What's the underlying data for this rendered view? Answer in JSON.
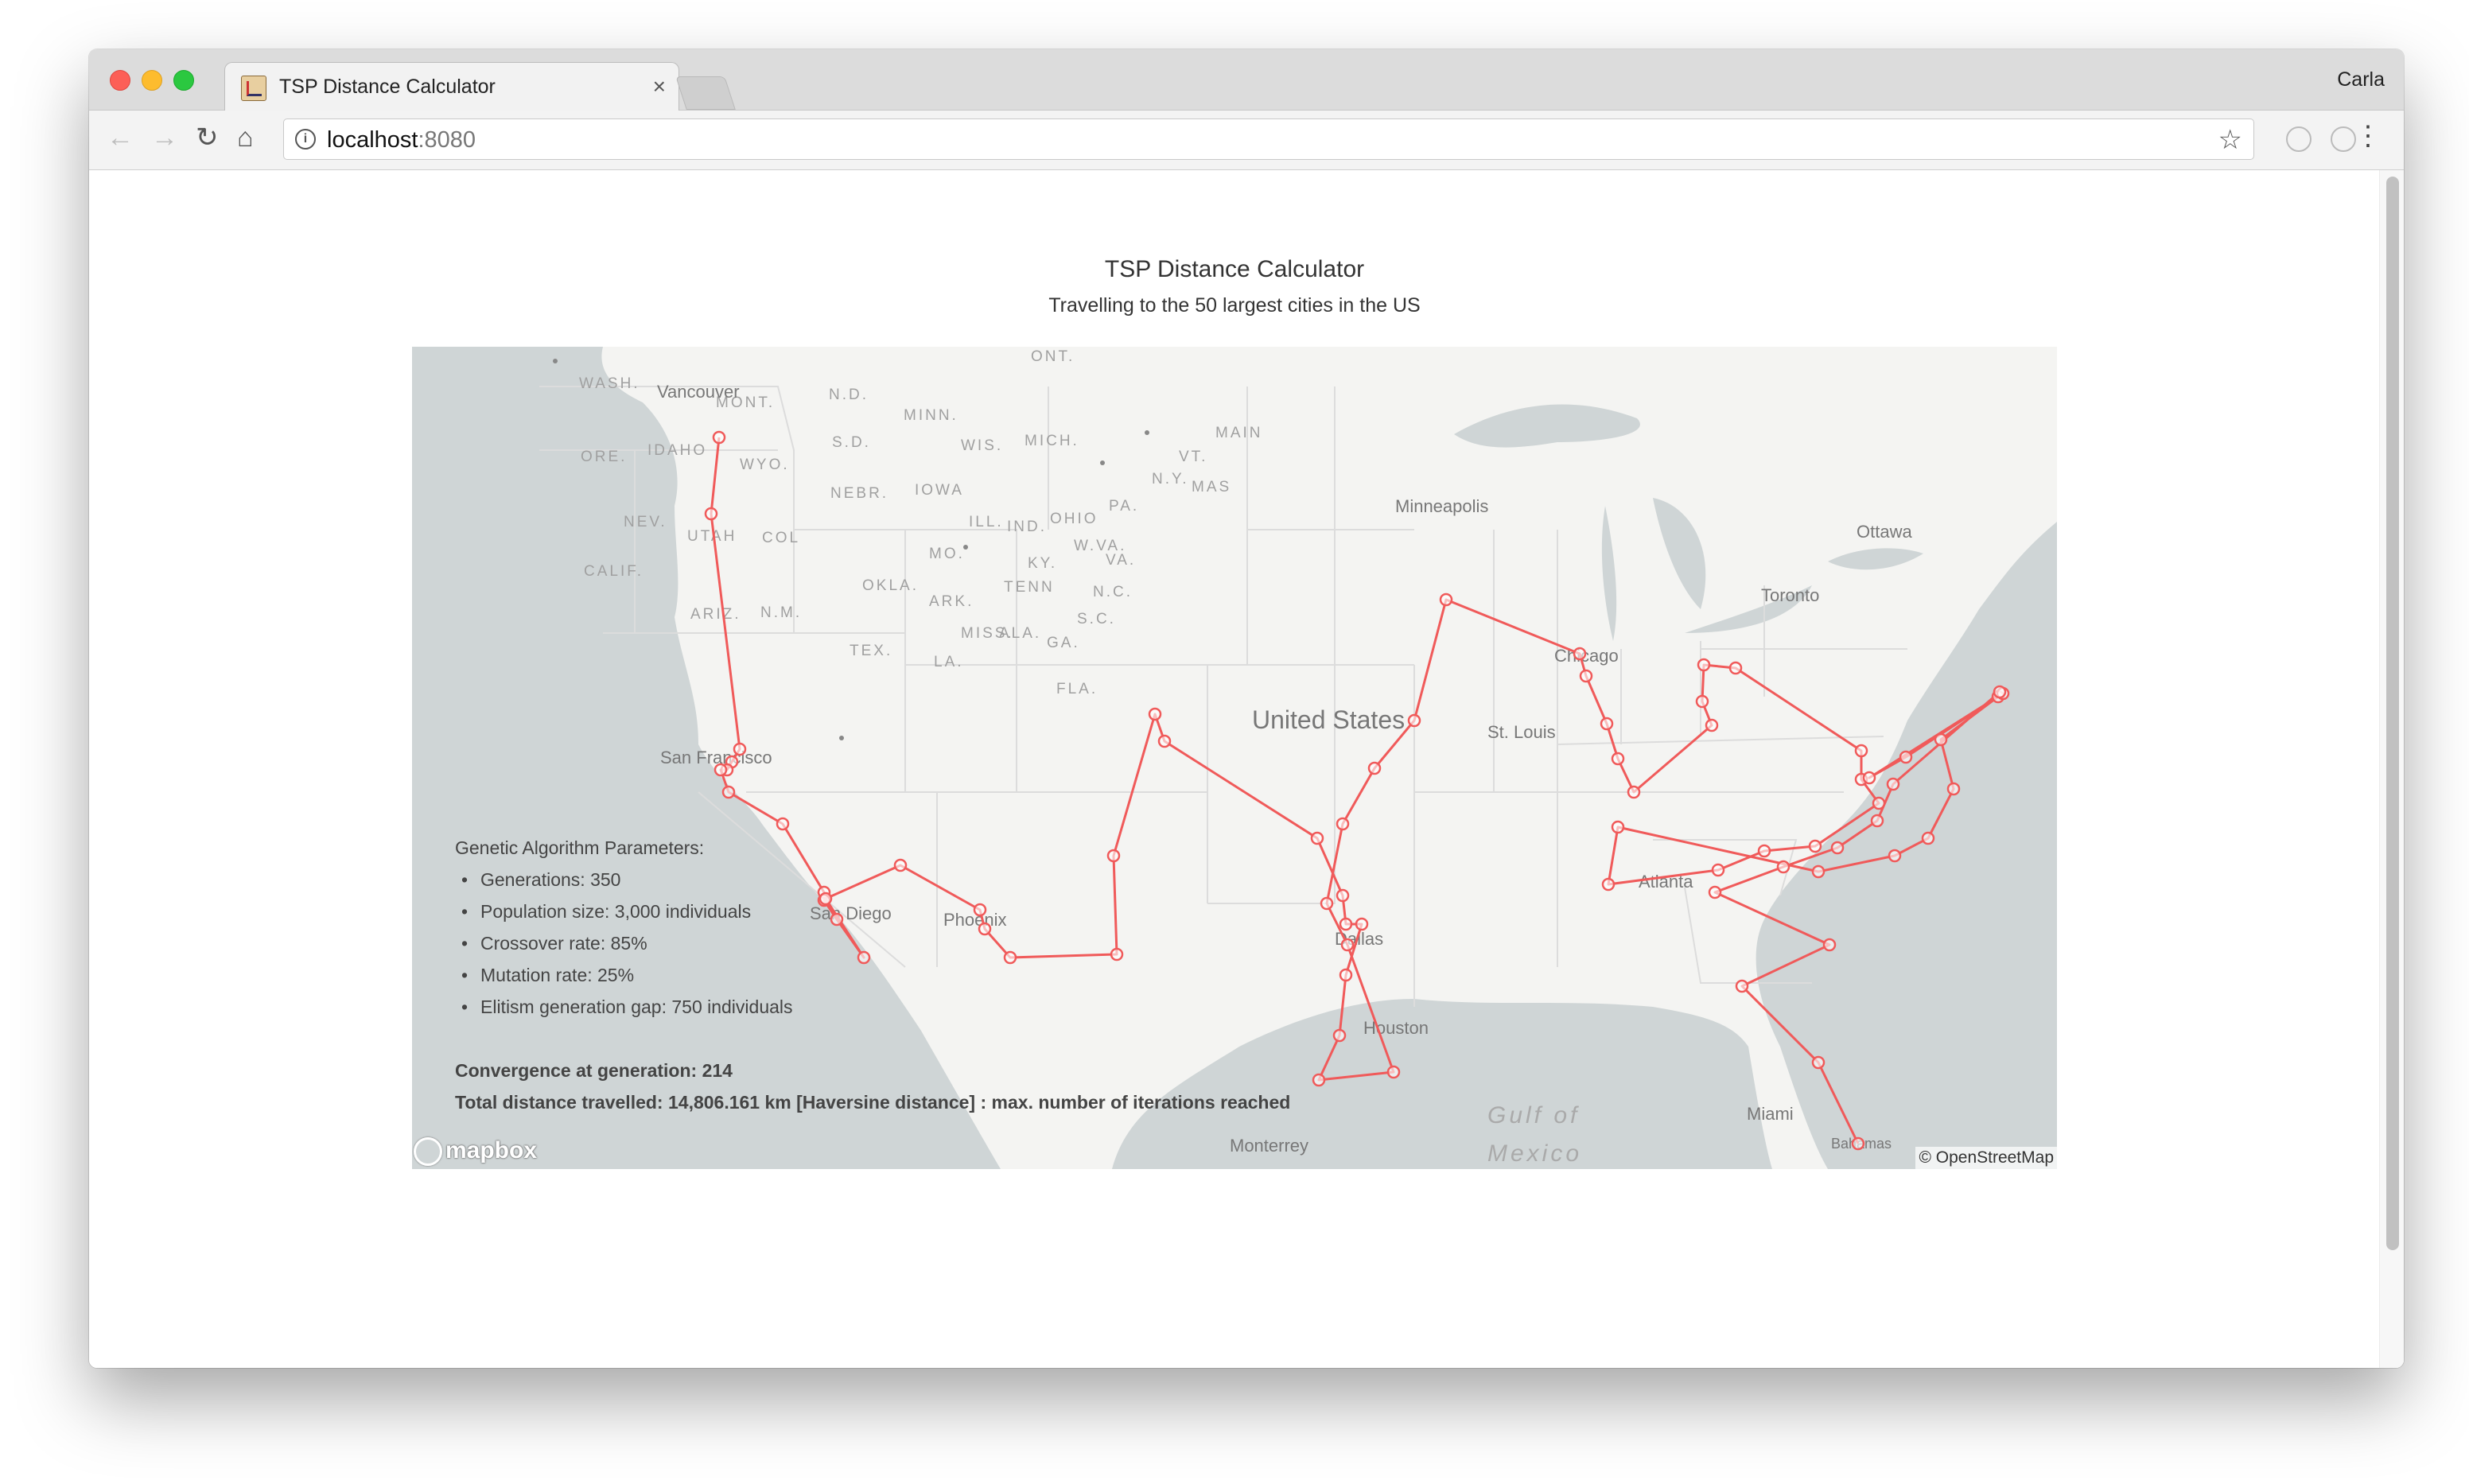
{
  "browser": {
    "tab_title": "TSP Distance Calculator",
    "tab_close": "×",
    "profile_name": "Carla",
    "url_host": "localhost",
    "url_port": ":8080",
    "icons": {
      "back": "arrow-left",
      "forward": "arrow-right",
      "reload": "reload",
      "home": "home",
      "info": "info",
      "star": "star",
      "menu": "vertical-dots"
    }
  },
  "page": {
    "title": "TSP Distance Calculator",
    "subtitle": "Travelling to the 50 largest cities in the US"
  },
  "map": {
    "route_color": "#f05a5a",
    "labels": {
      "country": "United States",
      "gulf_line1": "Gulf of",
      "gulf_line2": "Mexico",
      "states": [
        "WASH.",
        "ORE.",
        "IDAHO",
        "MONT.",
        "WYO.",
        "N.D.",
        "S.D.",
        "NEBR.",
        "MINN.",
        "IOWA",
        "WIS.",
        "MICH.",
        "ILL.",
        "IND.",
        "OHIO",
        "PA.",
        "N.Y.",
        "VT.",
        "MAS",
        "MAIN",
        "NEV.",
        "UTAH",
        "COL",
        "CALIF.",
        "ARIZ.",
        "N.M.",
        "OKLA.",
        "TEX.",
        "ARK.",
        "MO.",
        "KY.",
        "W.VA.",
        "VA.",
        "TENN",
        "N.C.",
        "S.C.",
        "GA.",
        "ALA.",
        "MISS.",
        "LA.",
        "FLA.",
        "ONT."
      ],
      "cities": [
        "Vancouver",
        "San Francisco",
        "San Diego",
        "Phoenix",
        "Dallas",
        "Houston",
        "Minneapolis",
        "Chicago",
        "St. Louis",
        "Toronto",
        "Ottawa",
        "Atlanta",
        "Miami",
        "Monterrey",
        "Bahamas"
      ]
    },
    "logo": "mapbox",
    "attribution": "© OpenStreetMap"
  },
  "parameters": {
    "heading": "Genetic Algorithm Parameters:",
    "items": [
      "Generations: 350",
      "Population size: 3,000 individuals",
      "Crossover rate: 85%",
      "Mutation rate: 25%",
      "Elitism generation gap: 750 individuals"
    ],
    "convergence": "Convergence at generation: 214",
    "total_distance": "Total distance travelled: 14,806.161 km [Haversine distance] : max. number of iterations reached"
  }
}
